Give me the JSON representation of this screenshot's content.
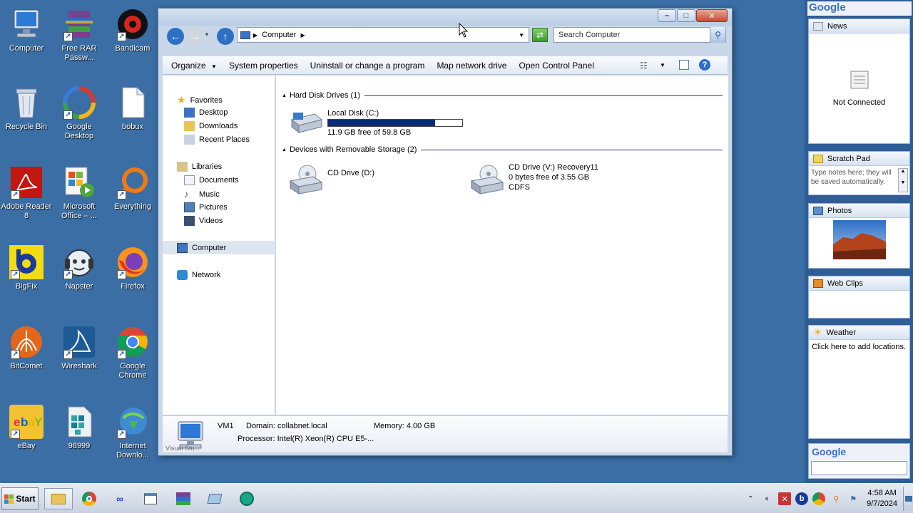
{
  "desktop": {
    "icons": [
      {
        "label": "Computer"
      },
      {
        "label": "Free RAR Passw..."
      },
      {
        "label": "Bandicam"
      },
      {
        "label": "Recycle Bin"
      },
      {
        "label": "Google Desktop"
      },
      {
        "label": "bobux"
      },
      {
        "label": "Adobe Reader 8"
      },
      {
        "label": "Microsoft Office – ..."
      },
      {
        "label": "Everything"
      },
      {
        "label": "BigFix"
      },
      {
        "label": "Napster"
      },
      {
        "label": "Firefox"
      },
      {
        "label": "BitComet"
      },
      {
        "label": "Wireshark"
      },
      {
        "label": "Google Chrome"
      },
      {
        "label": "eBay"
      },
      {
        "label": "98999"
      },
      {
        "label": "Internet Downlo..."
      }
    ]
  },
  "window": {
    "address": {
      "location": "Computer"
    },
    "search": {
      "placeholder": "Search Computer"
    },
    "toolbar": {
      "organize": "Organize",
      "system_properties": "System properties",
      "uninstall": "Uninstall or change a program",
      "map_drive": "Map network drive",
      "control_panel": "Open Control Panel"
    },
    "nav": {
      "favorites": "Favorites",
      "desktop": "Desktop",
      "downloads": "Downloads",
      "recent": "Recent Places",
      "libraries": "Libraries",
      "documents": "Documents",
      "music": "Music",
      "pictures": "Pictures",
      "videos": "Videos",
      "computer": "Computer",
      "network": "Network"
    },
    "groups": {
      "hdd": "Hard Disk Drives (1)",
      "removable": "Devices with Removable Storage (2)"
    },
    "drives": {
      "c": {
        "name": "Local Disk (C:)",
        "free": "11.9 GB free of 59.8 GB",
        "used_fraction": 0.8
      },
      "d": {
        "name": "CD Drive (D:)"
      },
      "v": {
        "name": "CD Drive (V:) Recovery11",
        "free": "0 bytes free of 3.55 GB",
        "fs": "CDFS"
      }
    },
    "details": {
      "name": "VM1",
      "domain": "Domain: collabnet.local",
      "memory": "Memory: 4.00 GB",
      "processor": "Processor: Intel(R) Xeon(R) CPU E5-...",
      "hidden_label": "Visual Stu..."
    }
  },
  "sidebar": {
    "logo": "Google",
    "news": {
      "title": "News",
      "status": "Not Connected"
    },
    "scratch": {
      "title": "Scratch Pad",
      "text": "Type notes here; they will be saved automatically."
    },
    "photos": {
      "title": "Photos"
    },
    "webclips": {
      "title": "Web Clips"
    },
    "weather": {
      "title": "Weather",
      "text": "Click here to add locations."
    },
    "search_logo": "Google"
  },
  "taskbar": {
    "start": "Start",
    "time": "4:58 AM",
    "date": "9/7/2024"
  },
  "colors": {
    "desktop": "#3a6ea5",
    "drive_bar": "#0a2a78",
    "accent": "#1d4d9a"
  }
}
